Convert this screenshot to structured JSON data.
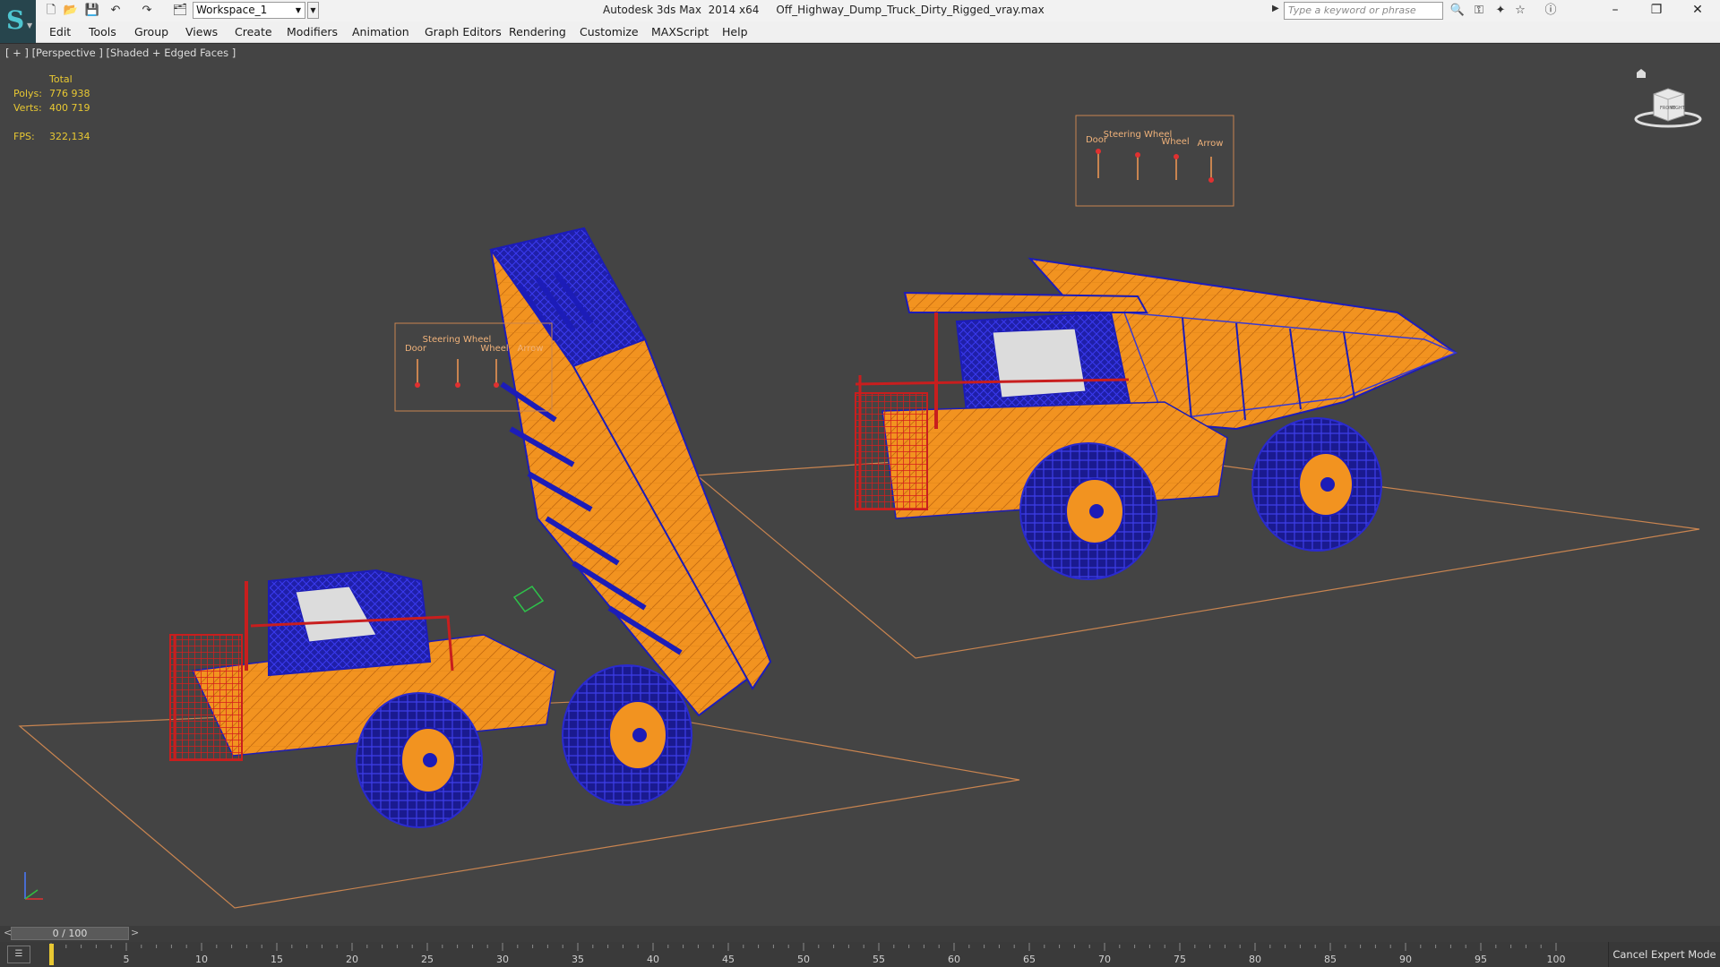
{
  "titlebar": {
    "workspace": "Workspace_1",
    "title": "Autodesk 3ds Max  2014 x64     Off_Highway_Dump_Truck_Dirty_Rigged_vray.max",
    "search_placeholder": "Type a keyword or phrase"
  },
  "menu": [
    "Edit",
    "Tools",
    "Group",
    "Views",
    "Create",
    "Modifiers",
    "Animation",
    "Graph Editors",
    "Rendering",
    "Customize",
    "MAXScript",
    "Help"
  ],
  "viewport": {
    "label": "[ + ] [Perspective ] [Shaded + Edged Faces ]",
    "stats": {
      "header": "Total",
      "polys_label": "Polys:",
      "polys_value": "776 938",
      "verts_label": "Verts:",
      "verts_value": "400 719",
      "fps_label": "FPS:",
      "fps_value": "322,134"
    },
    "viewcube": {
      "face_left": "FRONT",
      "face_right": "RIGHT"
    },
    "rig_controls": [
      "Door",
      "Steering Wheel",
      "Wheel",
      "Arrow"
    ]
  },
  "timeline": {
    "position": "0 / 100",
    "ticks": [
      "0",
      "5",
      "10",
      "15",
      "20",
      "25",
      "30",
      "35",
      "40",
      "45",
      "50",
      "55",
      "60",
      "65",
      "70",
      "75",
      "80",
      "85",
      "90",
      "95",
      "100"
    ],
    "cancel_expert": "Cancel Expert Mode"
  },
  "colors": {
    "viewport_bg": "#444444",
    "stats_text": "#e8c832",
    "truck_body": "#f08c1a",
    "wire_blue": "#2a2ad0",
    "frame_red": "#c81e1e",
    "grid_outline": "#c88450"
  }
}
